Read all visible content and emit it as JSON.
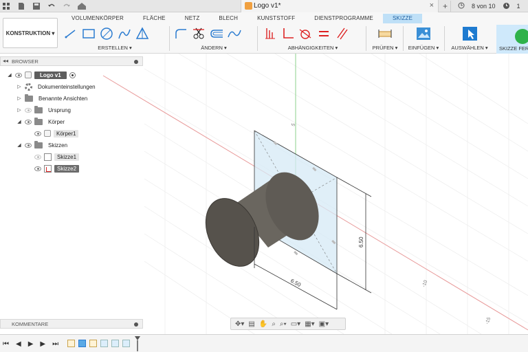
{
  "titlebar": {
    "document_title": "Logo v1*",
    "close_symbol": "×",
    "add_tab_symbol": "+",
    "version_text": "8 von 10",
    "clock_count": "1"
  },
  "ribbon": {
    "workspace_button": "KONSTRUKTION ▾",
    "tabs": [
      "VOLUMENKÖRPER",
      "FLÄCHE",
      "NETZ",
      "BLECH",
      "KUNSTSTOFF",
      "DIENSTPROGRAMME",
      "SKIZZE"
    ],
    "active_tab": "SKIZZE",
    "groups": {
      "erstellen": "ERSTELLEN ▾",
      "aendern": "ÄNDERN ▾",
      "abhaengigkeiten": "ABHÄNGIGKEITEN ▾",
      "pruefen": "PRÜFEN ▾",
      "einfuegen": "EINFÜGEN ▾",
      "auswaehlen": "AUSWÄHLEN ▾",
      "skizze_fertig": "SKIZZE FER"
    }
  },
  "browser": {
    "header": "BROWSER",
    "root": "Logo v1",
    "items": {
      "dokumenteinstellungen": "Dokumenteinstellungen",
      "benannte_ansichten": "Benannte Ansichten",
      "ursprung": "Ursprung",
      "koerper": "Körper",
      "koerper1": "Körper1",
      "skizzen": "Skizzen",
      "skizze1": "Skizze1",
      "skizze2": "Skizze2"
    }
  },
  "comments": {
    "header": "KOMMENTARE"
  },
  "viewport": {
    "axis_labels": [
      "5",
      "-10",
      "-15"
    ],
    "dimension_vertical": "6.50",
    "dimension_horizontal": "6.50"
  },
  "colors": {
    "accent_tab": "#bfe0f7",
    "axis_red": "#e07070",
    "axis_green": "#5cb85c",
    "sketch_plane": "#cfe6f3",
    "cylinder": "#5d5a55"
  }
}
